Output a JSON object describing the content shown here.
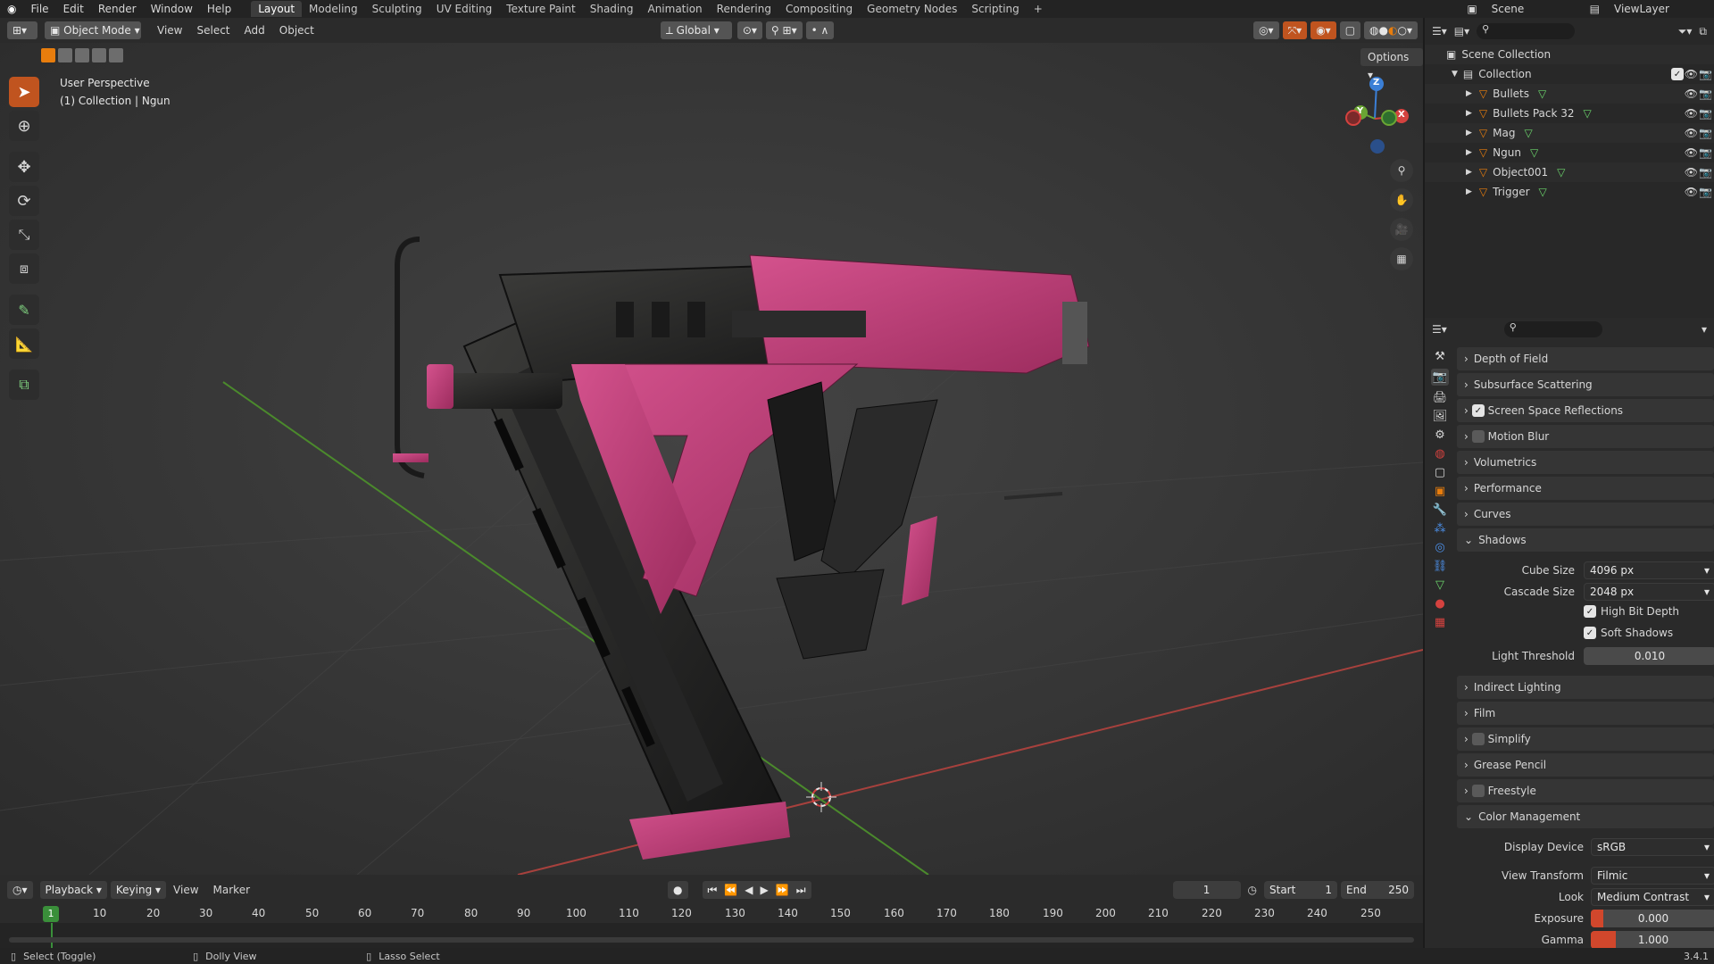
{
  "top_menu": {
    "items": [
      "File",
      "Edit",
      "Render",
      "Window",
      "Help"
    ],
    "workspaces": [
      "Layout",
      "Modeling",
      "Sculpting",
      "UV Editing",
      "Texture Paint",
      "Shading",
      "Animation",
      "Rendering",
      "Compositing",
      "Geometry Nodes",
      "Scripting"
    ],
    "active_workspace": "Layout",
    "scene": "Scene",
    "view_layer": "ViewLayer"
  },
  "viewport_header": {
    "mode": "Object Mode",
    "menus": [
      "View",
      "Select",
      "Add",
      "Object"
    ],
    "transform_orientation": "Global",
    "options": "Options"
  },
  "viewport": {
    "perspective": "User Perspective",
    "collection_info": "(1) Collection | Ngun",
    "gizmo_z": "Z",
    "gizmo_y": "Y",
    "gizmo_x": "X"
  },
  "outliner": {
    "root": "Scene Collection",
    "collection": "Collection",
    "objects": [
      "Bullets",
      "Bullets Pack 32",
      "Mag",
      "Ngun",
      "Object001",
      "Trigger"
    ]
  },
  "properties": {
    "panels_top": [
      {
        "label": "Depth of Field",
        "checkbox": null
      },
      {
        "label": "Subsurface Scattering",
        "checkbox": null
      },
      {
        "label": "Screen Space Reflections",
        "checkbox": true
      },
      {
        "label": "Motion Blur",
        "checkbox": false
      },
      {
        "label": "Volumetrics",
        "checkbox": null
      },
      {
        "label": "Performance",
        "checkbox": null
      },
      {
        "label": "Curves",
        "checkbox": null
      },
      {
        "label": "Shadows",
        "checkbox": null
      }
    ],
    "shadows": {
      "cube_size_label": "Cube Size",
      "cube_size": "4096 px",
      "cascade_size_label": "Cascade Size",
      "cascade_size": "2048 px",
      "high_bit_depth": "High Bit Depth",
      "soft_shadows": "Soft Shadows",
      "light_threshold_label": "Light Threshold",
      "light_threshold": "0.010"
    },
    "panels_bottom": [
      {
        "label": "Indirect Lighting",
        "checkbox": null
      },
      {
        "label": "Film",
        "checkbox": null
      },
      {
        "label": "Simplify",
        "checkbox": false
      },
      {
        "label": "Grease Pencil",
        "checkbox": null
      },
      {
        "label": "Freestyle",
        "checkbox": false
      },
      {
        "label": "Color Management",
        "checkbox": null
      }
    ],
    "color_management": {
      "display_device_label": "Display Device",
      "display_device": "sRGB",
      "view_transform_label": "View Transform",
      "view_transform": "Filmic",
      "look_label": "Look",
      "look": "Medium Contrast",
      "exposure_label": "Exposure",
      "exposure": "0.000",
      "gamma_label": "Gamma",
      "gamma": "1.000"
    }
  },
  "timeline": {
    "menus": [
      "Playback",
      "Keying",
      "View",
      "Marker"
    ],
    "current_frame": "1",
    "start_label": "Start",
    "start": "1",
    "end_label": "End",
    "end": "250",
    "ruler_marks": [
      "10",
      "20",
      "30",
      "40",
      "50",
      "60",
      "70",
      "80",
      "90",
      "100",
      "110",
      "120",
      "130",
      "140",
      "150",
      "160",
      "170",
      "180",
      "190",
      "200",
      "210",
      "220",
      "230",
      "240",
      "250"
    ],
    "playhead": "1"
  },
  "status_bar": {
    "left": "Select (Toggle)",
    "middle": "Dolly View",
    "right": "Lasso Select",
    "version": "3.4.1"
  },
  "colors": {
    "accent": "#e87d0d",
    "gun_pink": "#c23a78",
    "active_tool": "#c0541f",
    "axis_red": "#d4423f",
    "axis_green": "#6aa534",
    "axis_blue": "#3b7fd6"
  }
}
